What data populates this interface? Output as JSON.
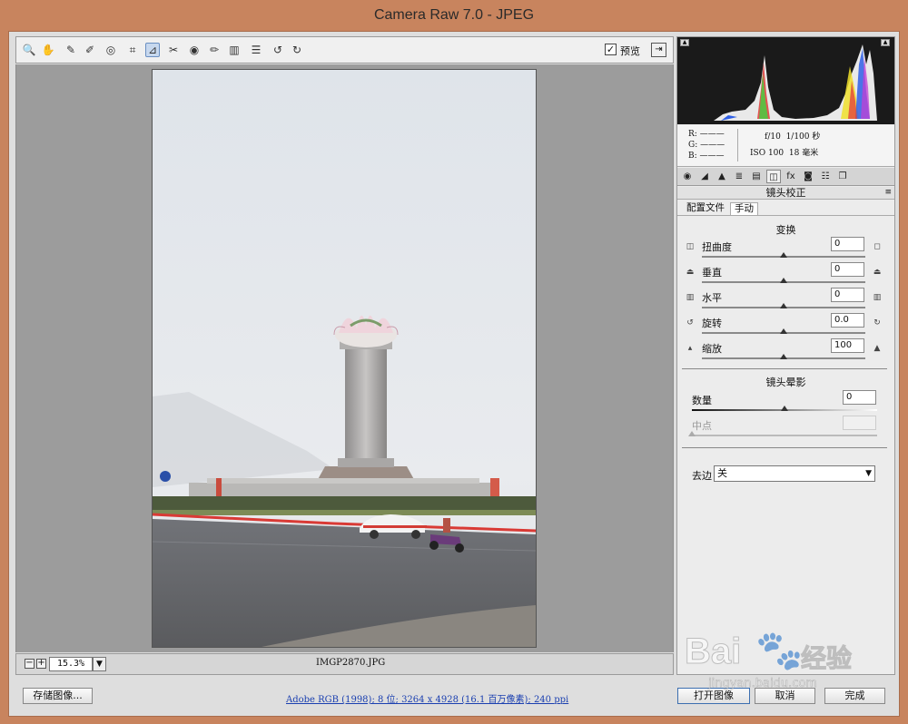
{
  "window": {
    "title": "Camera Raw 7.0 -  JPEG"
  },
  "toolbar": {
    "tools": [
      {
        "name": "zoom-tool-icon",
        "glyph": "🔍"
      },
      {
        "name": "hand-tool-icon",
        "glyph": "✋"
      },
      {
        "name": "white-balance-tool-icon",
        "glyph": "✎"
      },
      {
        "name": "color-sampler-tool-icon",
        "glyph": "✐"
      },
      {
        "name": "targeted-adjustment-tool-icon",
        "glyph": "◎"
      },
      {
        "name": "crop-tool-icon",
        "glyph": "⌗"
      },
      {
        "name": "straighten-tool-icon",
        "glyph": "⊿"
      },
      {
        "name": "spot-removal-tool-icon",
        "glyph": "✂"
      },
      {
        "name": "red-eye-tool-icon",
        "glyph": "◉"
      },
      {
        "name": "adjustment-brush-icon",
        "glyph": "✏"
      },
      {
        "name": "graduated-filter-icon",
        "glyph": "▥"
      },
      {
        "name": "preferences-icon",
        "glyph": "☰"
      },
      {
        "name": "rotate-ccw-icon",
        "glyph": "↺"
      },
      {
        "name": "rotate-cw-icon",
        "glyph": "↻"
      }
    ],
    "preview_checked": "✓",
    "preview_label": "预览",
    "fullscreen_glyph": "⇥"
  },
  "status": {
    "zoom_out": "−",
    "zoom_in": "+",
    "zoom_value": "15.3%",
    "zoom_dropdown": "▼",
    "filename": "IMGP2870.JPG"
  },
  "info": {
    "r_label": "R:",
    "g_label": "G:",
    "b_label": "B:",
    "r_value": "———",
    "g_value": "———",
    "b_value": "———",
    "aperture": "f/10",
    "shutter": "1/100 秒",
    "iso": "ISO 100",
    "focal": "18 毫米"
  },
  "panel": {
    "title": "镜头校正",
    "menu_glyph": "≡",
    "subtabs": [
      "配置文件",
      "手动"
    ],
    "transform": {
      "heading": "变换",
      "rows": [
        {
          "label": "扭曲度",
          "value": "0"
        },
        {
          "label": "垂直",
          "value": "0"
        },
        {
          "label": "水平",
          "value": "0"
        },
        {
          "label": "旋转",
          "value": "0.0"
        },
        {
          "label": "缩放",
          "value": "100"
        }
      ]
    },
    "vignetting": {
      "heading": "镜头晕影",
      "amount_label": "数量",
      "amount_value": "0",
      "midpoint_label": "中点",
      "midpoint_value": ""
    },
    "defringe": {
      "label": "去边",
      "value": "关"
    }
  },
  "bottom": {
    "save_label": "存储图像...",
    "workflow_link": "Adobe RGB (1998); 8 位; 3264 x 4928 (16.1 百万像素); 240 ppi",
    "open_label": "打开图像",
    "cancel_label": "取消",
    "done_label": "完成"
  },
  "watermark": {
    "text": "Bai",
    "sub": "经验",
    "url": "jingyan.baidu.com"
  }
}
